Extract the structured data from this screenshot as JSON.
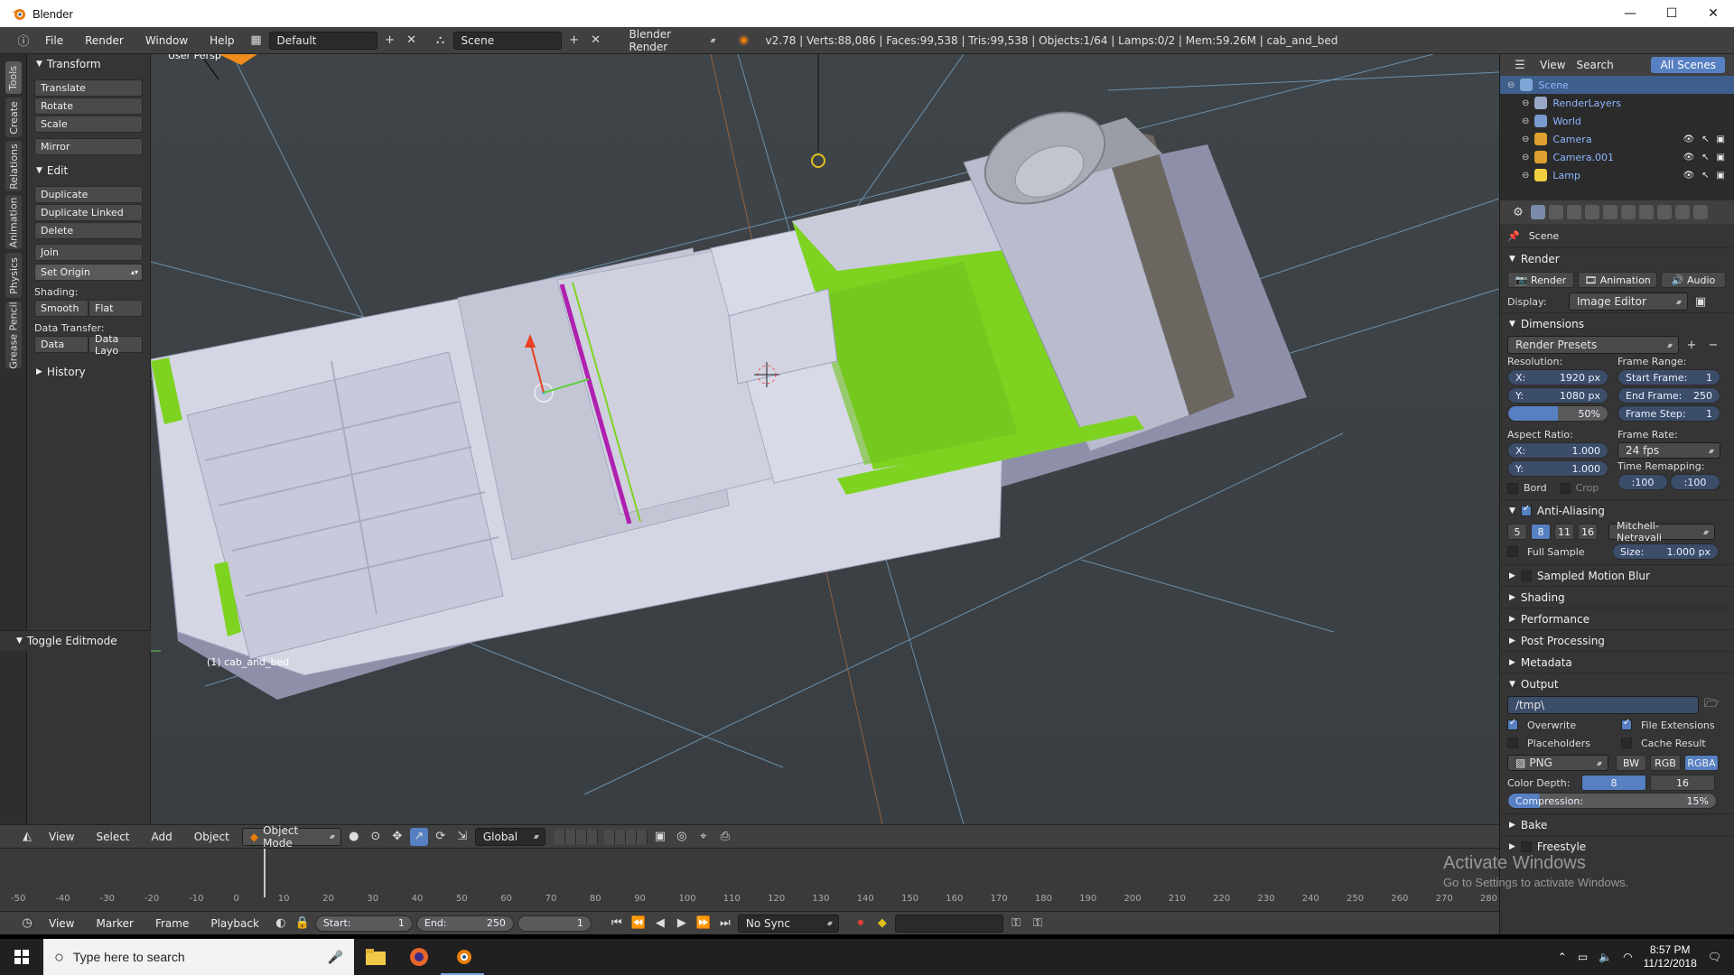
{
  "window": {
    "title": "Blender",
    "controls": [
      "—",
      "☐",
      "✕"
    ]
  },
  "info_header": {
    "menus": [
      "File",
      "Render",
      "Window",
      "Help"
    ],
    "layout": "Default",
    "scene": "Scene",
    "engine": "Blender Render",
    "stats": "v2.78 | Verts:88,086 | Faces:99,538 | Tris:99,538 | Objects:1/64 | Lamps:0/2 | Mem:59.26M | cab_and_bed"
  },
  "tabs": [
    "Tools",
    "Create",
    "Relations",
    "Animation",
    "Physics",
    "Grease Pencil"
  ],
  "toolshelf": {
    "transform": {
      "title": "Transform",
      "buttons": [
        "Translate",
        "Rotate",
        "Scale",
        "Mirror"
      ]
    },
    "edit": {
      "title": "Edit",
      "buttons": [
        "Duplicate",
        "Duplicate Linked",
        "Delete",
        "Join"
      ],
      "set_origin": "Set Origin",
      "shading_label": "Shading:",
      "shading": [
        "Smooth",
        "Flat"
      ],
      "data_transfer_label": "Data Transfer:",
      "data_transfer": [
        "Data",
        "Data Layo"
      ]
    },
    "history": "History",
    "toggle_editmode": "Toggle Editmode"
  },
  "viewport": {
    "persp_label": "User Persp",
    "object_label": "(1) cab_and_bed",
    "colors": {
      "body": "#d6d8e6",
      "green": "#7ed321",
      "magenta": "#b020b0",
      "wire": "#8fd0ff"
    }
  },
  "view_header": {
    "menus": [
      "View",
      "Select",
      "Add",
      "Object"
    ],
    "mode": "Object Mode",
    "orientation": "Global"
  },
  "timeline": {
    "ticks": [
      "-50",
      "-40",
      "-30",
      "-20",
      "-10",
      "0",
      "10",
      "20",
      "30",
      "40",
      "50",
      "60",
      "70",
      "80",
      "90",
      "100",
      "110",
      "120",
      "130",
      "140",
      "150",
      "160",
      "170",
      "180",
      "190",
      "200",
      "210",
      "220",
      "230",
      "240",
      "250",
      "260",
      "270",
      "280"
    ],
    "menus": [
      "View",
      "Marker",
      "Frame",
      "Playback"
    ],
    "start_label": "Start:",
    "start": "1",
    "end_label": "End:",
    "end": "250",
    "current": "1",
    "sync": "No Sync"
  },
  "outliner": {
    "menus": [
      "View",
      "Search"
    ],
    "filter": "All Scenes",
    "items": [
      {
        "label": "Scene",
        "color": "#7fa6d9"
      },
      {
        "label": "RenderLayers",
        "color": "#9aa8c8"
      },
      {
        "label": "World",
        "color": "#7a9ad0"
      },
      {
        "label": "Camera",
        "color": "#e0a030"
      },
      {
        "label": "Camera.001",
        "color": "#e0a030"
      },
      {
        "label": "Lamp",
        "color": "#f0d040"
      }
    ]
  },
  "properties": {
    "context": "Scene",
    "render": {
      "title": "Render",
      "buttons": [
        "Render",
        "Animation",
        "Audio"
      ],
      "display_label": "Display:",
      "display": "Image Editor"
    },
    "dimensions": {
      "title": "Dimensions",
      "presets": "Render Presets",
      "resolution_label": "Resolution:",
      "res_x_label": "X:",
      "res_x": "1920 px",
      "res_y_label": "Y:",
      "res_y": "1080 px",
      "res_pct": "50%",
      "res_pct_value": 0.5,
      "frame_range_label": "Frame Range:",
      "start_label": "Start Frame:",
      "start": "1",
      "end_label": "End Frame:",
      "end": "250",
      "step_label": "Frame Step:",
      "step": "1",
      "aspect_label": "Aspect Ratio:",
      "asp_x_label": "X:",
      "asp_x": "1.000",
      "asp_y_label": "Y:",
      "asp_y": "1.000",
      "frame_rate_label": "Frame Rate:",
      "fps": "24 fps",
      "time_remap_label": "Time Remapping:",
      "remap_old": "100",
      "remap_new": "100",
      "bord": "Bord",
      "crop": "Crop"
    },
    "aa": {
      "title": "Anti-Aliasing",
      "samples": [
        "5",
        "8",
        "11",
        "16"
      ],
      "filter": "Mitchell-Netravali",
      "full_sample": "Full Sample",
      "size_label": "Size:",
      "size": "1.000 px"
    },
    "collapsed": [
      "Sampled Motion Blur",
      "Shading",
      "Performance",
      "Post Processing",
      "Metadata"
    ],
    "output": {
      "title": "Output",
      "path": "/tmp\\",
      "overwrite": "Overwrite",
      "file_ext": "File Extensions",
      "placeholders": "Placeholders",
      "cache": "Cache Result",
      "format": "PNG",
      "channels": [
        "BW",
        "RGB",
        "RGBA"
      ],
      "depth_label": "Color Depth:",
      "depths": [
        "8",
        "16"
      ],
      "compression_label": "Compression:",
      "compression": "15%",
      "compression_value": 0.15
    },
    "bake": "Bake",
    "freestyle": "Freestyle"
  },
  "watermark": {
    "line1": "Activate Windows",
    "line2": "Go to Settings to activate Windows."
  },
  "taskbar": {
    "search_placeholder": "Type here to search",
    "time": "8:57 PM",
    "date": "11/12/2018"
  }
}
